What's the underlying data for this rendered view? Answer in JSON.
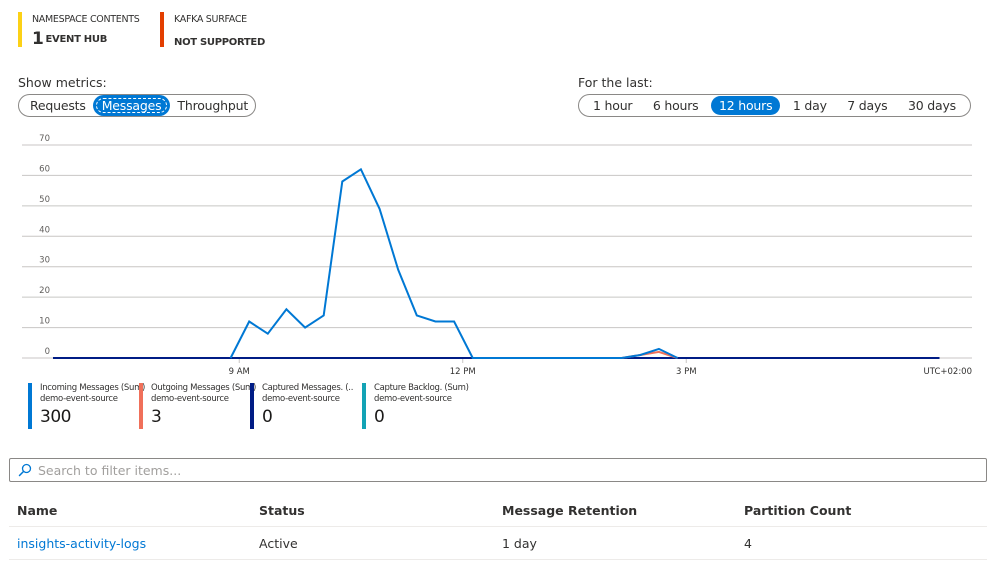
{
  "summary": {
    "namespace_contents": {
      "label": "NAMESPACE CONTENTS",
      "count": "1",
      "unit": "EVENT HUB",
      "color": "#fcd116"
    },
    "kafka_surface": {
      "label": "KAFKA SURFACE",
      "value": "NOT SUPPORTED",
      "color": "#e33e00"
    }
  },
  "metrics_selector": {
    "label": "Show metrics:",
    "options": [
      "Requests",
      "Messages",
      "Throughput"
    ],
    "selected": "Messages"
  },
  "time_selector": {
    "label": "For the last:",
    "options": [
      "1 hour",
      "6 hours",
      "12 hours",
      "1 day",
      "7 days",
      "30 days"
    ],
    "selected": "12 hours"
  },
  "chart_data": {
    "type": "line",
    "title": "",
    "xlabel": "",
    "ylabel": "",
    "timezone_label": "UTC+02:00",
    "ylim": [
      0,
      70
    ],
    "yticks": [
      "0",
      "10",
      "20",
      "30",
      "40",
      "50",
      "60",
      "70"
    ],
    "xlim_hours": [
      6.5,
      18.5
    ],
    "xticks": [
      {
        "hour": 9,
        "label": "9 AM"
      },
      {
        "hour": 12,
        "label": "12 PM"
      },
      {
        "hour": 15,
        "label": "3 PM"
      }
    ],
    "grid": true,
    "series": [
      {
        "name": "Capture Backlog. (Sum)",
        "color": "#13a3b5",
        "points": [
          [
            "06:30",
            0
          ],
          [
            "18:24",
            0
          ]
        ]
      },
      {
        "name": "Captured Messages. (Sum)",
        "color": "#001c85",
        "points": [
          [
            "06:30",
            0
          ],
          [
            "18:24",
            0
          ]
        ]
      },
      {
        "name": "Outgoing Messages (Sum)",
        "color": "#f0705a",
        "points": [
          [
            "14:08",
            0
          ],
          [
            "14:23",
            1
          ],
          [
            "14:38",
            2
          ],
          [
            "14:53",
            0
          ]
        ]
      },
      {
        "name": "Incoming Messages (Sum)",
        "color": "#0078d4",
        "points": [
          [
            "08:53",
            0
          ],
          [
            "09:08",
            12
          ],
          [
            "09:23",
            8
          ],
          [
            "09:38",
            16
          ],
          [
            "09:53",
            10
          ],
          [
            "10:08",
            14
          ],
          [
            "10:23",
            58
          ],
          [
            "10:38",
            62
          ],
          [
            "10:53",
            49
          ],
          [
            "11:08",
            29
          ],
          [
            "11:23",
            14
          ],
          [
            "11:38",
            12
          ],
          [
            "11:53",
            12
          ],
          [
            "12:08",
            0
          ],
          [
            "14:08",
            0
          ],
          [
            "14:23",
            1
          ],
          [
            "14:38",
            3
          ],
          [
            "14:53",
            0
          ]
        ]
      }
    ]
  },
  "legend": [
    {
      "name": "Incoming Messages (Sum)",
      "source": "demo-event-source",
      "value": "300",
      "color": "#0078d4"
    },
    {
      "name": "Outgoing Messages (Sum)",
      "source": "demo-event-source",
      "value": "3",
      "color": "#f0705a"
    },
    {
      "name": "Captured Messages. (Sum)",
      "display_name": "Captured Messages. (..",
      "source": "demo-event-source",
      "value": "0",
      "color": "#001c85"
    },
    {
      "name": "Capture Backlog. (Sum)",
      "source": "demo-event-source",
      "value": "0",
      "color": "#13a3b5"
    }
  ],
  "search": {
    "placeholder": "Search to filter items...",
    "value": "",
    "icon": "search-icon"
  },
  "table": {
    "columns": [
      "Name",
      "Status",
      "Message Retention",
      "Partition Count"
    ],
    "rows": [
      {
        "name": "insights-activity-logs",
        "status": "Active",
        "retention": "1 day",
        "partitions": "4"
      }
    ]
  }
}
